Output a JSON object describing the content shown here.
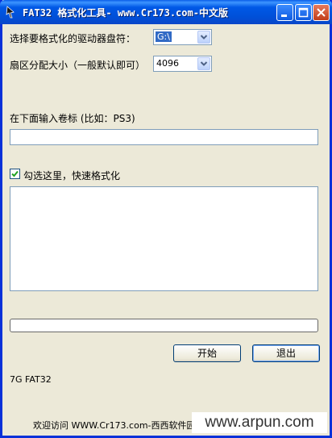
{
  "window": {
    "title": "FAT32 格式化工具- www.Cr173.com-中文版"
  },
  "form": {
    "drive_label": "选择要格式化的驱动器盘符：",
    "drive_value": "G:\\",
    "cluster_label": "扇区分配大小（一般默认即可）",
    "cluster_value": "4096",
    "volume_label": "在下面输入卷标 (比如：PS3)",
    "volume_value": "",
    "quick_format_label": "勾选这里，快速格式化",
    "quick_format_checked": true,
    "log_text": "",
    "progress": 0
  },
  "buttons": {
    "start": "开始",
    "exit": "退出"
  },
  "status": {
    "info": "7G FAT32",
    "footer": "欢迎访问 WWW.Cr173.com-西西软件园"
  },
  "watermark": "www.arpun.com",
  "icons": [
    "app-icon",
    "minimize-icon",
    "maximize-icon",
    "close-icon",
    "dropdown-arrow-icon",
    "checkmark-icon"
  ],
  "colors": {
    "titlebar": "#0058e6",
    "window_bg": "#ece9d8",
    "close_button": "#c13d1a",
    "field_border": "#7f9db9",
    "selection": "#316ac5"
  }
}
